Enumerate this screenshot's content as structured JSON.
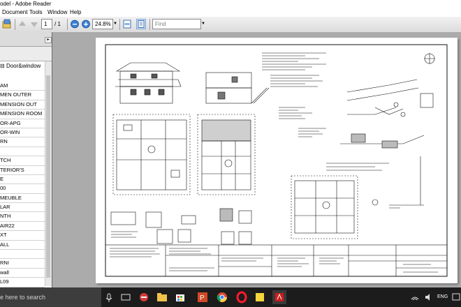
{
  "window": {
    "title": "odel - Adobe Reader"
  },
  "menu": [
    "Document",
    "Tools",
    "Window",
    "Help"
  ],
  "toolbar": {
    "page_current": "1",
    "page_total": "/ 1",
    "zoom": "24.8%",
    "find_placeholder": "Find"
  },
  "sidebar": {
    "tree_title": "Door&window",
    "items": [
      "AM",
      "MEN OUTER",
      "MENSION OUT",
      "MENSION ROOM",
      "OR-APG",
      "OR-WIN",
      "RN",
      "",
      "TCH",
      "TERIOR'S",
      "E",
      "00",
      "MEUBLE",
      "LAR",
      "NTH",
      "AIR22",
      "XT",
      "ALL",
      "",
      "RNI",
      "wall",
      "L09"
    ]
  },
  "taskbar": {
    "search_text": "e here to search",
    "lang": "ENG"
  }
}
